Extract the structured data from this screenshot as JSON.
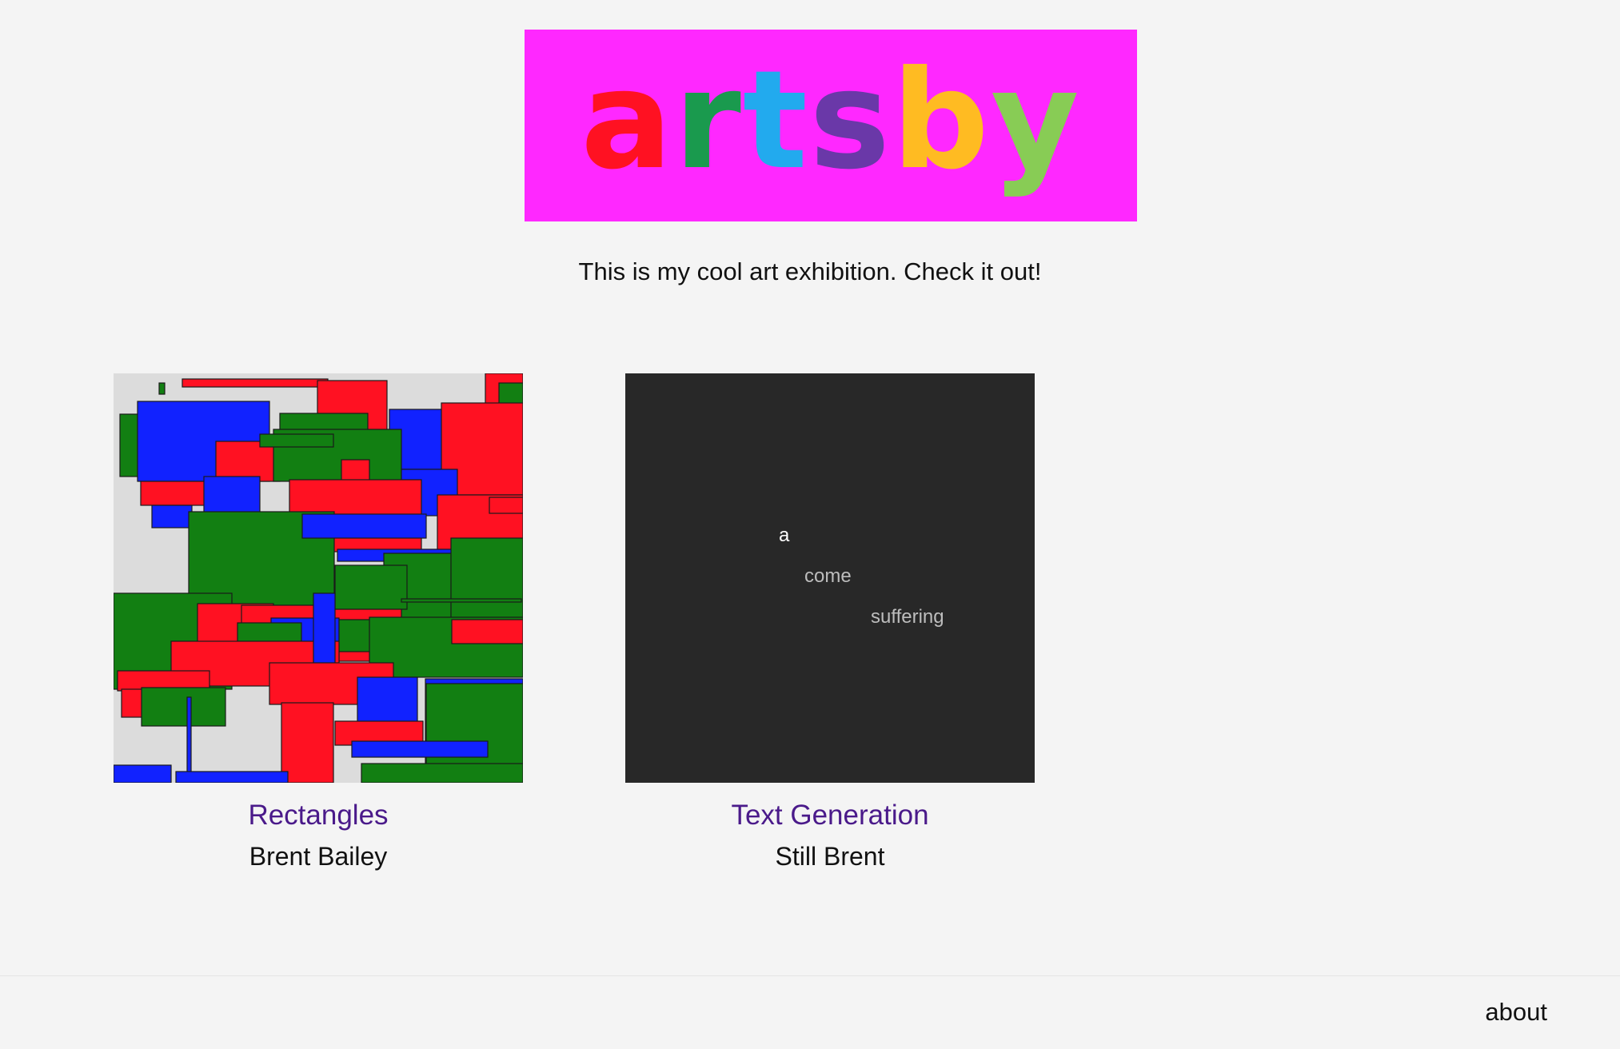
{
  "header": {
    "logo_letters": [
      "a",
      "r",
      "t",
      "s",
      "b",
      "y"
    ],
    "logo_colors": [
      "#ff1122",
      "#1a9a4e",
      "#22aaee",
      "#6a38a8",
      "#ffbb22",
      "#88cc55"
    ],
    "banner_color": "#ff28ff"
  },
  "tagline": "This is my cool art exhibition. Check it out!",
  "gallery": [
    {
      "title": "Rectangles",
      "author": "Brent Bailey"
    },
    {
      "title": "Text Generation",
      "author": "Still Brent",
      "words": [
        "a",
        "come",
        "suffering"
      ]
    }
  ],
  "footer": {
    "about_label": "about"
  },
  "colors": {
    "background": "#f4f4f4",
    "link": "#4a1a8a",
    "art_red": "#ff1122",
    "art_green": "#127f12",
    "art_blue": "#1122ff",
    "text_art_bg": "#282828"
  }
}
